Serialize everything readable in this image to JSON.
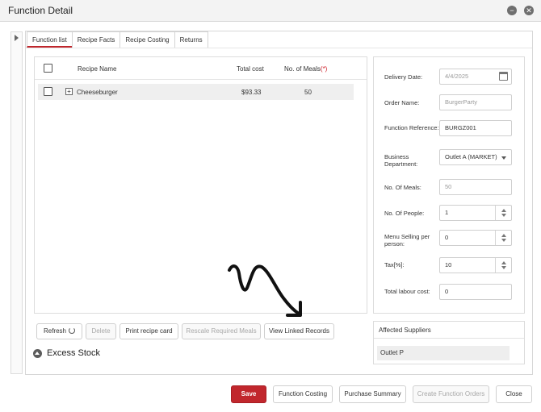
{
  "window": {
    "title": "Function Detail"
  },
  "tabs": [
    {
      "label": "Function list"
    },
    {
      "label": "Recipe Facts"
    },
    {
      "label": "Recipe Costing"
    },
    {
      "label": "Returns"
    }
  ],
  "table": {
    "columns": {
      "name": "Recipe Name",
      "cost": "Total cost",
      "meals": "No. of Meals",
      "required_mark": "(*)"
    },
    "rows": [
      {
        "name": "Cheeseburger",
        "cost": "$93.33",
        "meals": "50"
      }
    ]
  },
  "list_buttons": {
    "refresh": "Refresh",
    "delete": "Delete",
    "print": "Print recipe card",
    "rescale": "Rescale Required Meals",
    "linked": "View Linked Records"
  },
  "excess": {
    "label": "Excess Stock"
  },
  "form": {
    "delivery_date": {
      "label": "Delivery Date:",
      "value": "4/4/2025"
    },
    "order_name": {
      "label": "Order Name:",
      "placeholder": "BurgerParty"
    },
    "function_ref": {
      "label": "Function Reference:",
      "value": "BURGZ001"
    },
    "business_dept": {
      "label": "Business Department:",
      "value": "Outlet A (MARKET)"
    },
    "no_of_meals": {
      "label": "No. Of Meals:",
      "value": "50"
    },
    "no_of_people": {
      "label": "No. Of People:",
      "value": "1"
    },
    "menu_price": {
      "label": "Menu Selling per person:",
      "value": "0"
    },
    "tax": {
      "label": "Tax[%]:",
      "value": "10"
    },
    "labour_cost": {
      "label": "Total labour cost:",
      "value": "0"
    }
  },
  "suppliers": {
    "header": "Affected Suppliers",
    "items": [
      "Outlet P"
    ]
  },
  "footer": {
    "save": "Save",
    "function_costing": "Function Costing",
    "purchase_summary": "Purchase Summary",
    "create_orders": "Create Function Orders",
    "close": "Close"
  },
  "icons": {
    "minimize": "minimize-icon",
    "close": "close-icon",
    "calendar": "calendar-icon",
    "refresh": "refresh-icon",
    "collapse": "chevron-up-icon"
  },
  "colors": {
    "accent": "#c1272d"
  }
}
